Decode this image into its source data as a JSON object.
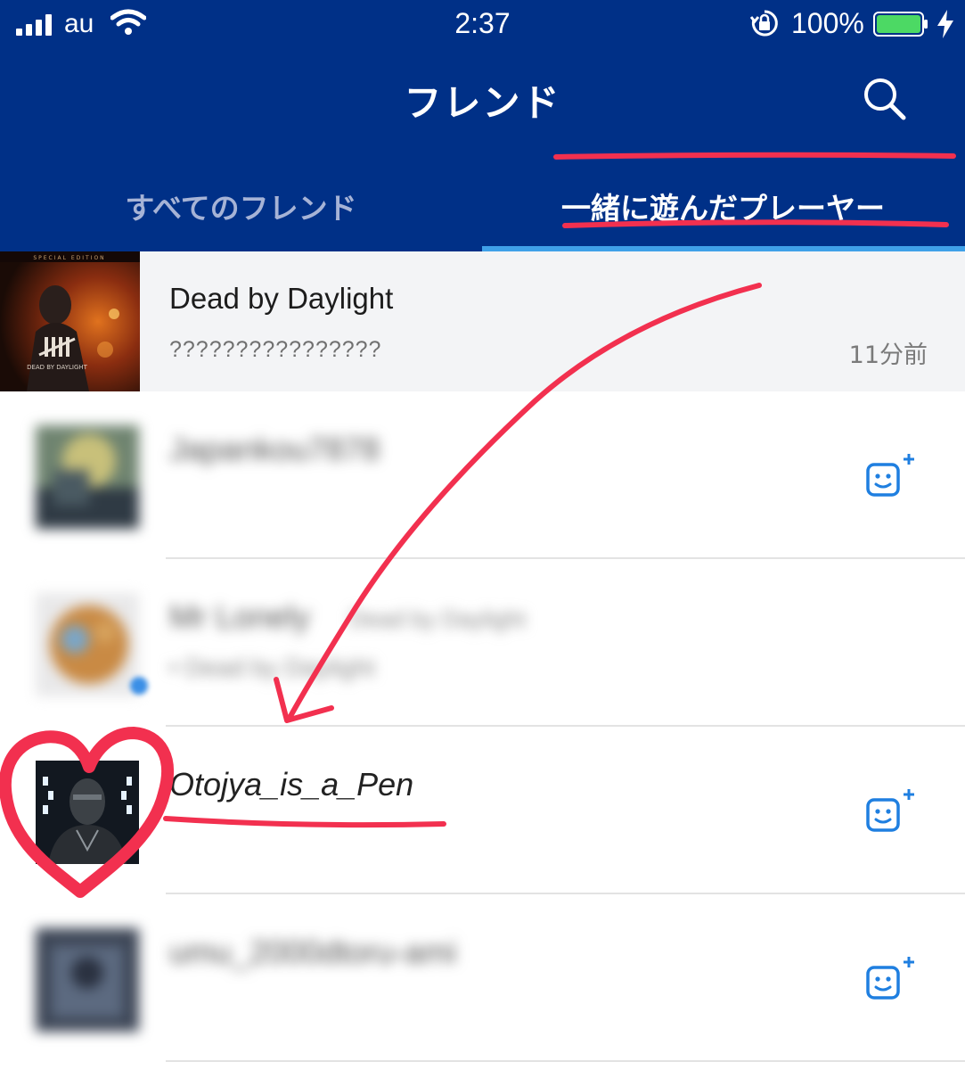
{
  "status_bar": {
    "carrier": "au",
    "time": "2:37",
    "battery_percent": "100%",
    "icons": [
      "signal-icon",
      "wifi-icon",
      "rotation-lock-icon",
      "battery-icon",
      "charging-icon"
    ]
  },
  "nav": {
    "title": "フレンド",
    "search_icon": "search-icon"
  },
  "tabs": [
    {
      "label": "すべてのフレンド",
      "selected": false
    },
    {
      "label": "一緒に遊んだプレーヤー",
      "selected": true
    }
  ],
  "game": {
    "cover_caption": "SPECIAL EDITION",
    "title": "Dead by Daylight",
    "subtitle": "????????????????",
    "time": "11分前"
  },
  "players": [
    {
      "name": "Japankou7878",
      "blurred": true,
      "action_icon": "add-friend-icon"
    },
    {
      "name": "Mr Lonely",
      "game_hint": "Dead by Daylight",
      "sub": "• Dead by Daylight",
      "blurred": true,
      "online": true
    },
    {
      "name": "Otojya_is_a_Pen",
      "blurred": false,
      "action_icon": "add-friend-icon"
    },
    {
      "name": "umu_2000dtoru-ami",
      "blurred": true,
      "action_icon": "add-friend-icon"
    }
  ],
  "colors": {
    "header_bg": "#003087",
    "tab_indicator": "#3fa0e8",
    "add_icon": "#1f7fe0",
    "annotation": "#f2304f"
  }
}
